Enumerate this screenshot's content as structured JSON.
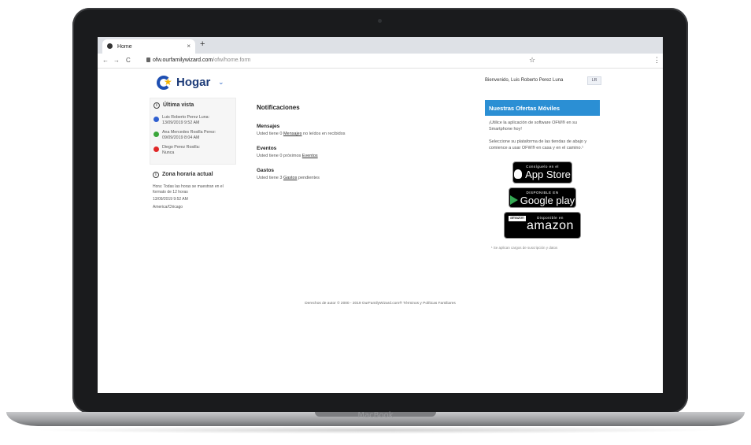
{
  "device": {
    "brand": "MacBook"
  },
  "browser": {
    "tab_title": "Home",
    "tab_close": "×",
    "new_tab": "+",
    "back": "←",
    "forward": "→",
    "reload": "C",
    "url_host": "ofw.ourfamilywizard.com",
    "url_path": "/ofw/home.form",
    "bookmark_star": "☆",
    "menu": "⋮"
  },
  "header": {
    "title": "Hogar",
    "chevron": "⌄",
    "welcome": "Bienvenido, Luis Roberto Perez Luna",
    "user_button": "LR"
  },
  "last_seen": {
    "title": "Última vista",
    "icon": "i",
    "users": [
      {
        "name": "Luis Roberto Perez Luna:",
        "date": "13/09/2019 9:52 AM",
        "color": "#2f5fd0"
      },
      {
        "name": "Ana Mercedes Rosilla Perez:",
        "date": "09/09/2019 8:04 AM",
        "color": "#3aa63a"
      },
      {
        "name": "Diego Perez Rosilla:",
        "date": "Nunca",
        "color": "#e02626"
      }
    ]
  },
  "timezone": {
    "title": "Zona horaria actual",
    "icon": "i",
    "lines": [
      "Hora: Todas las horas se muestran en el formato de 12 horas",
      "13/09/2019 9:52 AM",
      "America/Chicago"
    ]
  },
  "notifications": {
    "title": "Notificaciones",
    "sections": [
      {
        "heading": "Mensajes",
        "pre": "Usted tiene 0 ",
        "link": "Mensajes",
        "post": " no leídos en recibidos"
      },
      {
        "heading": "Eventos",
        "pre": "Usted tiene 0 próximos ",
        "link": "Eventos",
        "post": ""
      },
      {
        "heading": "Gastos",
        "pre": "Usted tiene 3 ",
        "link": "Gastos",
        "post": " pendientes"
      }
    ]
  },
  "offers": {
    "title": "Nuestras Ofertas Móviles",
    "p1": "¡Utilice la aplicación de software OFW® en su Smartphone hoy!",
    "p2": "Seleccione su plataforma de las tiendas de abajo y comience a usar OFW® en casa y en el camino.¹",
    "apple_small": "Consíguelo en el",
    "apple_big": "App Store",
    "google_small": "DISPONIBLE EN",
    "google_big": "Google play",
    "amazon_logo": "amazon",
    "amazon_app": "apps",
    "amazon_small": "Disponible en",
    "amazon_big": "amazon",
    "fineprint": "¹ Se aplican cargos de suscripción y datos"
  },
  "footer": {
    "text": "Derechos de autor © 2000 - 2019 OurFamilyWizard.com® Términos y Políticas Familiares"
  }
}
